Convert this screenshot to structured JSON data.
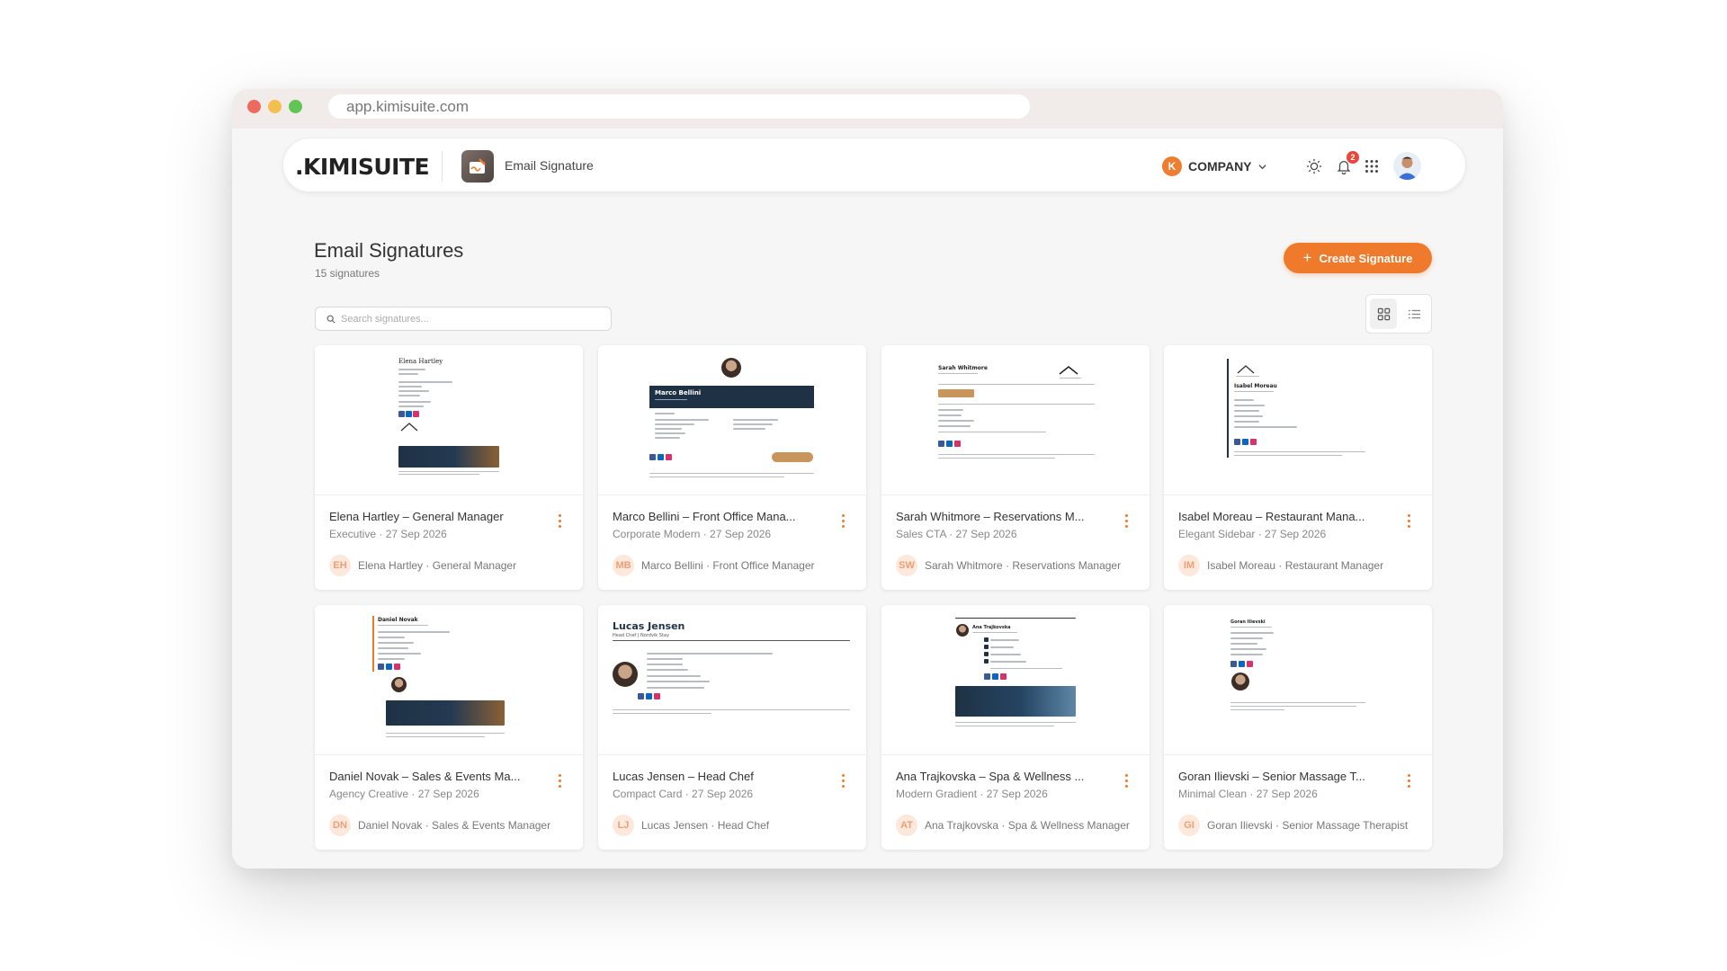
{
  "browser": {
    "url": "app.kimisuite.com"
  },
  "nav": {
    "logo": ".KIMISUITE",
    "app_name": "Email Signature",
    "company_initial": "K",
    "company_label": "COMPANY",
    "notification_count": "2"
  },
  "main": {
    "title": "Email Signatures",
    "subtitle": "15 signatures",
    "create_label": "Create Signature",
    "search_placeholder": "Search signatures..."
  },
  "cards": [
    {
      "title": "Elena Hartley – General Manager",
      "meta": "Executive · 27 Sep 2026",
      "initials": "EH",
      "owner": "Elena Hartley · General Manager",
      "preview_name": "Elena Hartley"
    },
    {
      "title": "Marco Bellini – Front Office Mana...",
      "meta": "Corporate Modern · 27 Sep 2026",
      "initials": "MB",
      "owner": "Marco Bellini · Front Office Manager",
      "preview_name": "Marco Bellini"
    },
    {
      "title": "Sarah Whitmore – Reservations M...",
      "meta": "Sales CTA · 27 Sep 2026",
      "initials": "SW",
      "owner": "Sarah Whitmore · Reservations Manager",
      "preview_name": "Sarah Whitmore"
    },
    {
      "title": "Isabel Moreau – Restaurant Mana...",
      "meta": "Elegant Sidebar · 27 Sep 2026",
      "initials": "IM",
      "owner": "Isabel Moreau · Restaurant Manager",
      "preview_name": "Isabel Moreau"
    },
    {
      "title": "Daniel Novak – Sales & Events Ma...",
      "meta": "Agency Creative · 27 Sep 2026",
      "initials": "DN",
      "owner": "Daniel Novak · Sales & Events Manager",
      "preview_name": "Daniel Novak"
    },
    {
      "title": "Lucas Jensen – Head Chef",
      "meta": "Compact Card · 27 Sep 2026",
      "initials": "LJ",
      "owner": "Lucas Jensen · Head Chef",
      "preview_name": "Lucas Jensen",
      "preview_role": "Head Chef | Nordvik Stay"
    },
    {
      "title": "Ana Trajkovska – Spa & Wellness ...",
      "meta": "Modern Gradient · 27 Sep 2026",
      "initials": "AT",
      "owner": "Ana Trajkovska · Spa & Wellness Manager",
      "preview_name": "Ana Trajkovska"
    },
    {
      "title": "Goran Ilievski – Senior Massage T...",
      "meta": "Minimal Clean · 27 Sep 2026",
      "initials": "GI",
      "owner": "Goran Ilievski · Senior Massage Therapist",
      "preview_name": "Goran Ilievski"
    }
  ],
  "colors": {
    "accent": "#f07a2c",
    "navy": "#1f3144"
  }
}
